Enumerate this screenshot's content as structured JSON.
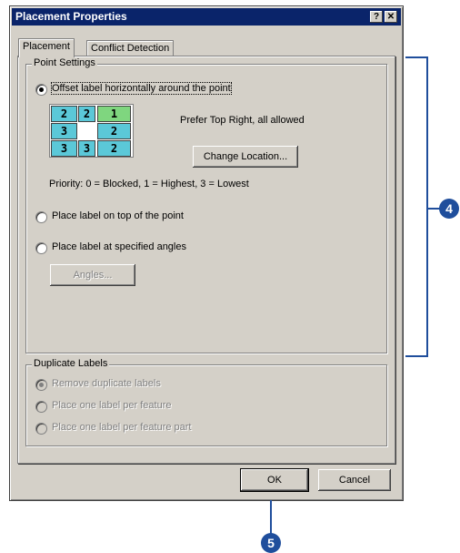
{
  "window": {
    "title": "Placement Properties",
    "help_btn": "?",
    "close_btn": "✕"
  },
  "tabs": [
    {
      "label": "Placement"
    },
    {
      "label": "Conflict Detection"
    }
  ],
  "point_settings": {
    "group_label": "Point Settings",
    "option_offset": "Offset label horizontally around the point",
    "grid": [
      [
        "2",
        "2",
        "1"
      ],
      [
        "3",
        "",
        "2"
      ],
      [
        "3",
        "3",
        "2"
      ]
    ],
    "preference_text": "Prefer Top Right, all allowed",
    "change_location_btn": "Change Location...",
    "priority_text": "Priority:  0 = Blocked, 1 = Highest, 3 = Lowest",
    "option_on_top": "Place label on top of the point",
    "option_angles": "Place label at specified angles",
    "angles_btn": "Angles..."
  },
  "duplicate_labels": {
    "group_label": "Duplicate Labels",
    "options": [
      "Remove duplicate labels",
      "Place one label per feature",
      "Place one label per feature part"
    ]
  },
  "footer": {
    "ok": "OK",
    "cancel": "Cancel"
  },
  "callouts": {
    "c4": "4",
    "c5": "5"
  },
  "colors": {
    "title_bar": "#0a246a",
    "callout": "#1f4e9c",
    "grid_blue": "#5bc8d8",
    "grid_green": "#7fd67f"
  }
}
